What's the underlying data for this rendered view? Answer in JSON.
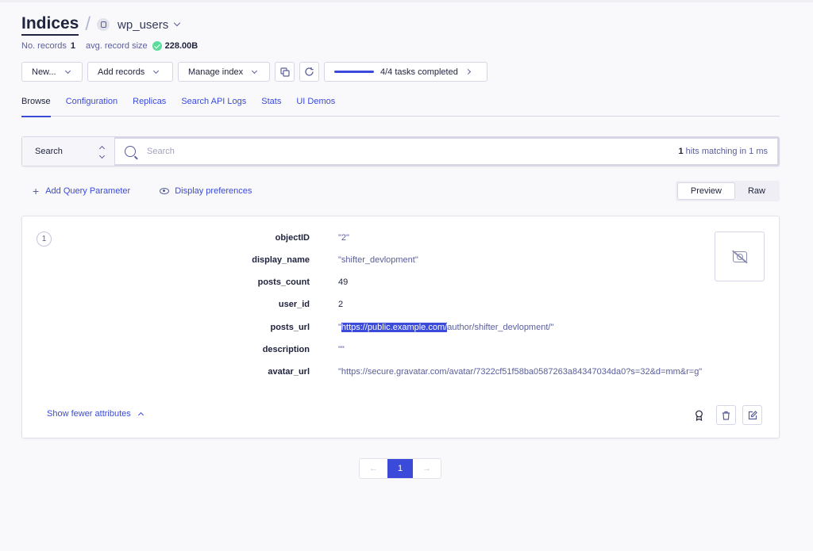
{
  "header": {
    "title": "Indices",
    "index_name": "wp_users"
  },
  "meta": {
    "records_label": "No. records",
    "records_value": "1",
    "size_label": "avg. record size",
    "size_value": "228.00B"
  },
  "toolbar": {
    "new_label": "New...",
    "add_records_label": "Add records",
    "manage_index_label": "Manage index",
    "tasks_label": "4/4 tasks completed",
    "tasks_progress": 1.0
  },
  "tabs": [
    {
      "label": "Browse",
      "active": true
    },
    {
      "label": "Configuration"
    },
    {
      "label": "Replicas"
    },
    {
      "label": "Search API Logs"
    },
    {
      "label": "Stats"
    },
    {
      "label": "UI Demos"
    }
  ],
  "search": {
    "type_label": "Search",
    "placeholder": "Search",
    "hits_count": "1",
    "hits_text": " hits matching in 1 ms"
  },
  "query": {
    "add_param_label": "Add Query Parameter",
    "display_prefs_label": "Display preferences",
    "preview_label": "Preview",
    "raw_label": "Raw"
  },
  "record": {
    "number": "1",
    "attributes": [
      {
        "key": "objectID",
        "value": "\"2\""
      },
      {
        "key": "display_name",
        "value": "\"shifter_devlopment\""
      },
      {
        "key": "posts_count",
        "value": "49"
      },
      {
        "key": "user_id",
        "value": "2"
      },
      {
        "key": "posts_url",
        "value_pre": "\"",
        "value_hl": "https://public.example.com/",
        "value_post": "author/shifter_devlopment/\""
      },
      {
        "key": "description",
        "value": "\"\""
      },
      {
        "key": "avatar_url",
        "value": "\"https://secure.gravatar.com/avatar/7322cf51f58ba0587263a84347034da0?s=32&d=mm&r=g\""
      }
    ],
    "show_fewer_label": "Show fewer attributes"
  },
  "pagination": {
    "prev": "←",
    "current": "1",
    "next": "→"
  },
  "colors": {
    "accent": "#3a4ad9",
    "success": "#5adc9a",
    "text": "#21243d",
    "muted": "#5a5e9a"
  }
}
